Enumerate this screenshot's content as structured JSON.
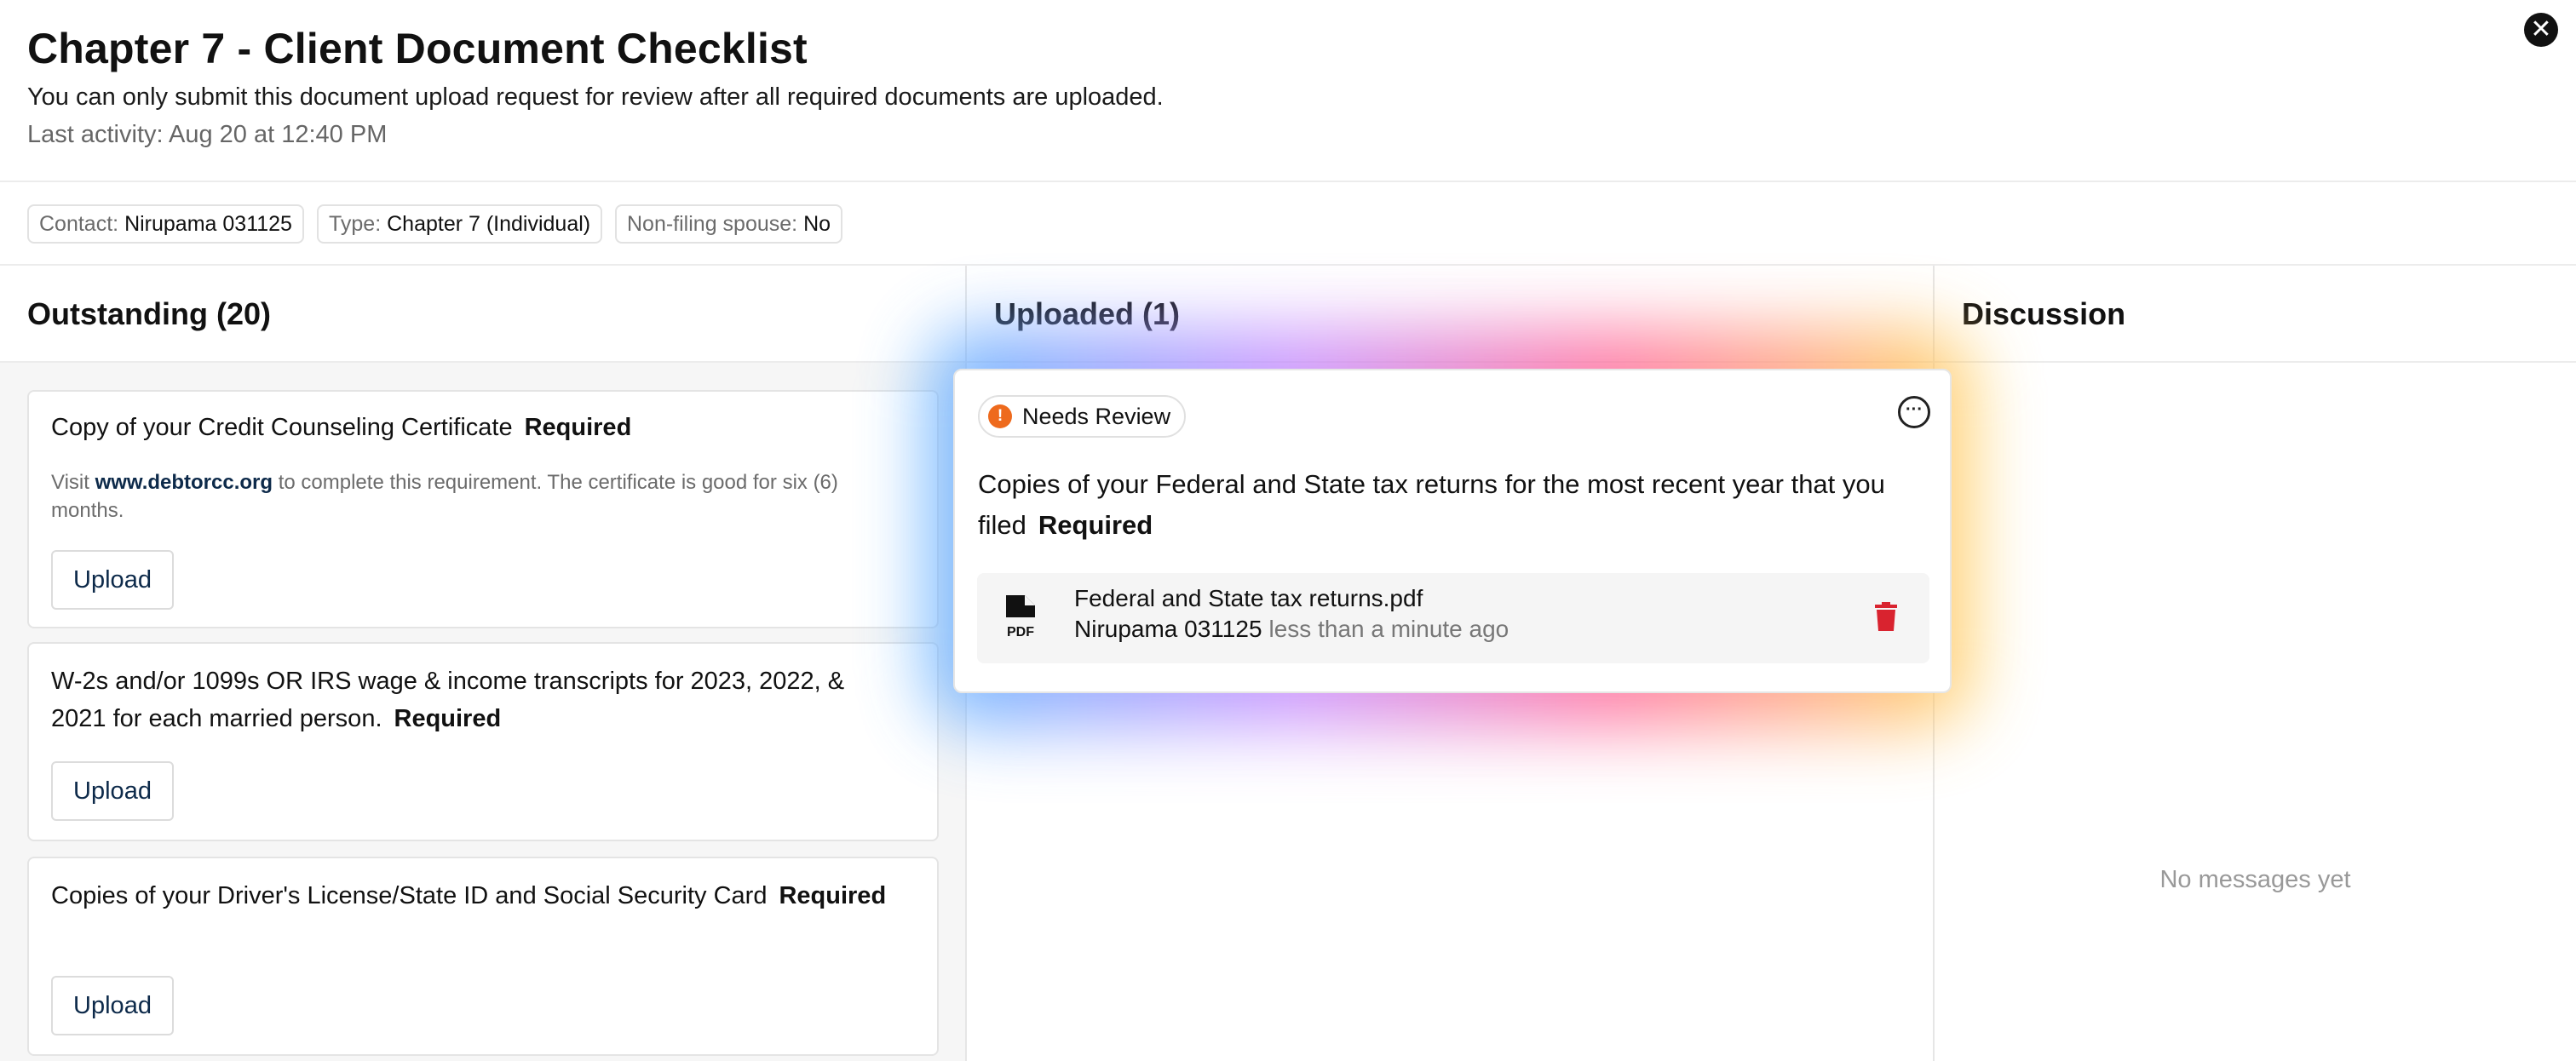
{
  "header": {
    "title": "Chapter 7 - Client Document Checklist",
    "subtitle": "You can only submit this document upload request for review after all required documents are uploaded.",
    "last_activity": "Last activity: Aug 20 at 12:40 PM",
    "close_glyph": "✕"
  },
  "meta": {
    "contact": {
      "label": "Contact:",
      "value": "Nirupama 031125"
    },
    "type": {
      "label": "Type:",
      "value": "Chapter 7 (Individual)"
    },
    "spouse": {
      "label": "Non-filing spouse:",
      "value": "No"
    }
  },
  "outstanding": {
    "heading": "Outstanding (20)",
    "required_label": "Required",
    "upload_label": "Upload",
    "items": [
      {
        "title": "Copy of your Credit Counseling Certificate",
        "desc_prefix": "Visit",
        "desc_link": "www.debtorcc.org",
        "desc_suffix": "to complete this requirement. The certificate is good for six (6) months."
      },
      {
        "title": "W-2s and/or 1099s OR IRS wage & income transcripts for 2023, 2022, & 2021 for each married person."
      },
      {
        "title": "Copies of your Driver's License/State ID and Social Security Card"
      }
    ]
  },
  "uploaded": {
    "heading": "Uploaded (1)",
    "card": {
      "status": "Needs Review",
      "status_glyph": "!",
      "more_glyph": "···",
      "title": "Copies of your Federal and State tax returns for the most recent year that you filed",
      "required_label": "Required",
      "file": {
        "name": "Federal and State tax returns.pdf",
        "uploader": "Nirupama 031125",
        "time": "less than a minute ago",
        "icon_text": "PDF"
      }
    }
  },
  "discussion": {
    "heading": "Discussion",
    "empty": "No messages yet"
  },
  "colors": {
    "link": "#0d2a4a",
    "warning": "#ee6a1d",
    "delete": "#d9232f",
    "muted": "#999999"
  }
}
